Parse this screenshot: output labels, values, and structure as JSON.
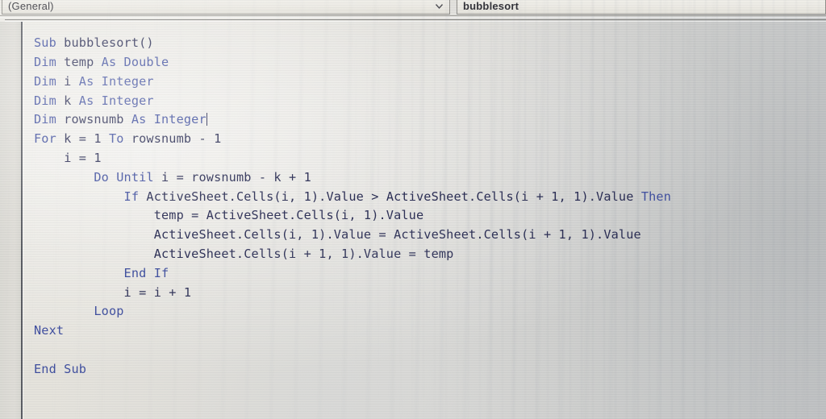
{
  "editor": {
    "object_combo": {
      "value": "(General)",
      "dropdown_icon": "chevron-down-icon"
    },
    "procedure_combo": {
      "value": "bubblesort",
      "dropdown_icon": "chevron-down-icon"
    }
  },
  "code": {
    "language": "VBA",
    "keyword_color": "#3a4a9c",
    "text_color": "#23264e",
    "background_color": "#e3e1da",
    "lines": [
      {
        "indent": 0,
        "tokens": [
          {
            "t": "Sub",
            "k": true
          },
          {
            "t": " bubblesort()",
            "k": false
          }
        ]
      },
      {
        "indent": 0,
        "tokens": [
          {
            "t": "Dim",
            "k": true
          },
          {
            "t": " temp ",
            "k": false
          },
          {
            "t": "As",
            "k": true
          },
          {
            "t": " ",
            "k": false
          },
          {
            "t": "Double",
            "k": true
          }
        ]
      },
      {
        "indent": 0,
        "tokens": [
          {
            "t": "Dim",
            "k": true
          },
          {
            "t": " i ",
            "k": false
          },
          {
            "t": "As",
            "k": true
          },
          {
            "t": " ",
            "k": false
          },
          {
            "t": "Integer",
            "k": true
          }
        ]
      },
      {
        "indent": 0,
        "tokens": [
          {
            "t": "Dim",
            "k": true
          },
          {
            "t": " k ",
            "k": false
          },
          {
            "t": "As",
            "k": true
          },
          {
            "t": " ",
            "k": false
          },
          {
            "t": "Integer",
            "k": true
          }
        ]
      },
      {
        "indent": 0,
        "tokens": [
          {
            "t": "Dim",
            "k": true
          },
          {
            "t": " rowsnumb ",
            "k": false
          },
          {
            "t": "As",
            "k": true
          },
          {
            "t": " ",
            "k": false
          },
          {
            "t": "Integer",
            "k": true
          }
        ],
        "caret": true
      },
      {
        "indent": 0,
        "tokens": [
          {
            "t": "For",
            "k": true
          },
          {
            "t": " k = 1 ",
            "k": false
          },
          {
            "t": "To",
            "k": true
          },
          {
            "t": " rowsnumb - 1",
            "k": false
          }
        ]
      },
      {
        "indent": 1,
        "tokens": [
          {
            "t": "i = 1",
            "k": false
          }
        ]
      },
      {
        "indent": 2,
        "tokens": [
          {
            "t": "Do Until",
            "k": true
          },
          {
            "t": " i = rowsnumb - k + 1",
            "k": false
          }
        ]
      },
      {
        "indent": 3,
        "tokens": [
          {
            "t": "If",
            "k": true
          },
          {
            "t": " ActiveSheet.Cells(i, 1).Value > ActiveSheet.Cells(i + 1, 1).Value ",
            "k": false
          },
          {
            "t": "Then",
            "k": true
          }
        ]
      },
      {
        "indent": 4,
        "tokens": [
          {
            "t": "temp = ActiveSheet.Cells(i, 1).Value",
            "k": false
          }
        ]
      },
      {
        "indent": 4,
        "tokens": [
          {
            "t": "ActiveSheet.Cells(i, 1).Value = ActiveSheet.Cells(i + 1, 1).Value",
            "k": false
          }
        ]
      },
      {
        "indent": 4,
        "tokens": [
          {
            "t": "ActiveSheet.Cells(i + 1, 1).Value = temp",
            "k": false
          }
        ]
      },
      {
        "indent": 3,
        "tokens": [
          {
            "t": "End If",
            "k": true
          }
        ]
      },
      {
        "indent": 3,
        "tokens": [
          {
            "t": "i = i + 1",
            "k": false
          }
        ]
      },
      {
        "indent": 2,
        "tokens": [
          {
            "t": "Loop",
            "k": true
          }
        ]
      },
      {
        "indent": 0,
        "tokens": [
          {
            "t": "Next",
            "k": true
          }
        ]
      },
      {
        "indent": 0,
        "tokens": []
      },
      {
        "indent": 0,
        "tokens": [
          {
            "t": "End Sub",
            "k": true
          }
        ]
      }
    ]
  }
}
